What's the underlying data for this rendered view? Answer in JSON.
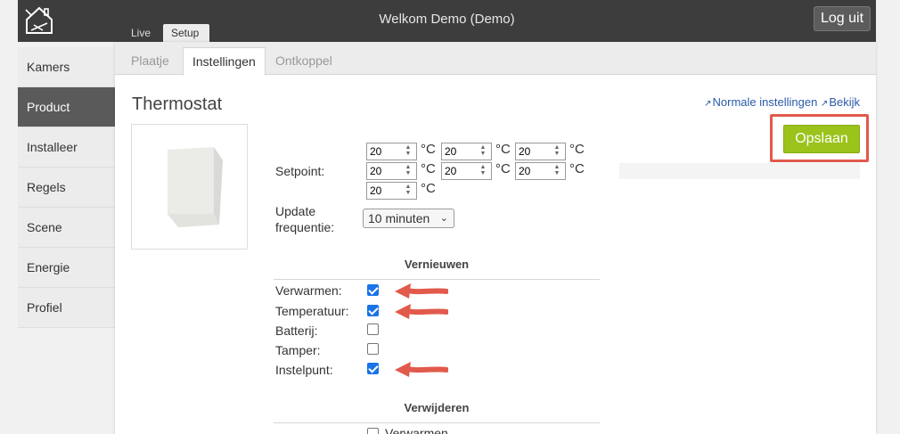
{
  "header": {
    "welcome": "Welkom Demo (Demo)",
    "logout_label": "Log uit",
    "tabs": [
      {
        "label": "Live"
      },
      {
        "label": "Setup"
      }
    ]
  },
  "sidebar": {
    "items": [
      {
        "label": "Kamers"
      },
      {
        "label": "Product"
      },
      {
        "label": "Installeer"
      },
      {
        "label": "Regels"
      },
      {
        "label": "Scene"
      },
      {
        "label": "Energie"
      },
      {
        "label": "Profiel"
      }
    ],
    "active_index": 1
  },
  "subtabs": [
    {
      "label": "Plaatje"
    },
    {
      "label": "Instellingen"
    },
    {
      "label": "Ontkoppel"
    }
  ],
  "page": {
    "title": "Thermostat",
    "link_normal": "Normale instellingen",
    "link_view": "Bekijk",
    "save_label": "Opslaan"
  },
  "form": {
    "setpoint_label": "Setpoint:",
    "setpoints": [
      {
        "value": "20",
        "unit": "°C"
      },
      {
        "value": "20",
        "unit": "°C"
      },
      {
        "value": "20",
        "unit": "°C"
      },
      {
        "value": "20",
        "unit": "°C"
      },
      {
        "value": "20",
        "unit": "°C"
      },
      {
        "value": "20",
        "unit": "°C"
      },
      {
        "value": "20",
        "unit": "°C"
      }
    ],
    "update_label_1": "Update",
    "update_label_2": "frequentie:",
    "update_value": "10 minuten"
  },
  "vernieuwen": {
    "heading": "Vernieuwen",
    "items": [
      {
        "label": "Verwarmen:",
        "checked": true
      },
      {
        "label": "Temperatuur:",
        "checked": true
      },
      {
        "label": "Batterij:",
        "checked": false
      },
      {
        "label": "Tamper:",
        "checked": false
      },
      {
        "label": "Instelpunt:",
        "checked": true
      }
    ]
  },
  "verwijderen": {
    "heading": "Verwijderen",
    "items": [
      {
        "label": "Verwarmen",
        "checked": false
      }
    ]
  },
  "colors": {
    "accent": "#9bc31c",
    "highlight": "#e15a4c",
    "checkbox": "#1a73e8"
  }
}
